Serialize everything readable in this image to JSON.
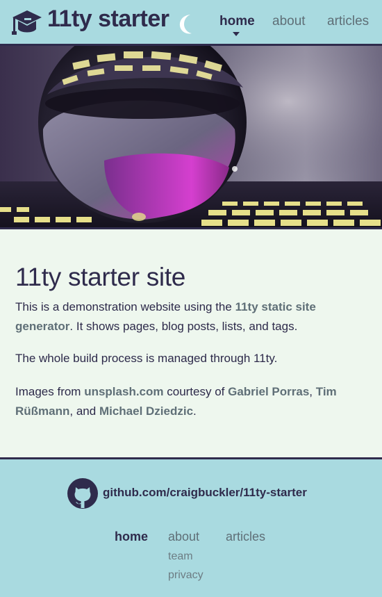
{
  "header": {
    "site_title": "11ty starter",
    "logo_icon": "graduation-cap-icon",
    "theme_toggle_icon": "moon-icon",
    "nav": [
      {
        "label": "home",
        "active": true
      },
      {
        "label": "about",
        "active": false
      },
      {
        "label": "articles",
        "active": false
      }
    ]
  },
  "hero": {
    "description_icon": "glass-sphere-image"
  },
  "main": {
    "title": "11ty starter site",
    "p1": {
      "before": "This is a demonstration website using the ",
      "link": "11ty static site generator",
      "after": ". It shows pages, blog posts, lists, and tags."
    },
    "p2": "The whole build process is managed through 11ty.",
    "p3": {
      "before": "Images from ",
      "link1": "unsplash.com",
      "mid1": " courtesy of ",
      "link2": "Gabriel Porras",
      "mid2": ", ",
      "link3": "Tim Rüßmann",
      "mid3": ", and ",
      "link4": "Michael Dziedzic",
      "after": "."
    }
  },
  "footer": {
    "github_icon": "github-icon",
    "github_link": "github.com/craigbuckler/11ty-starter",
    "nav": {
      "home": "home",
      "about": "about",
      "articles": "articles",
      "team": "team",
      "privacy": "privacy"
    }
  },
  "colors": {
    "header_bg": "#a9dae0",
    "page_bg": "#eef7ee",
    "dark": "#2f2b4c",
    "link": "#5f6f77"
  }
}
